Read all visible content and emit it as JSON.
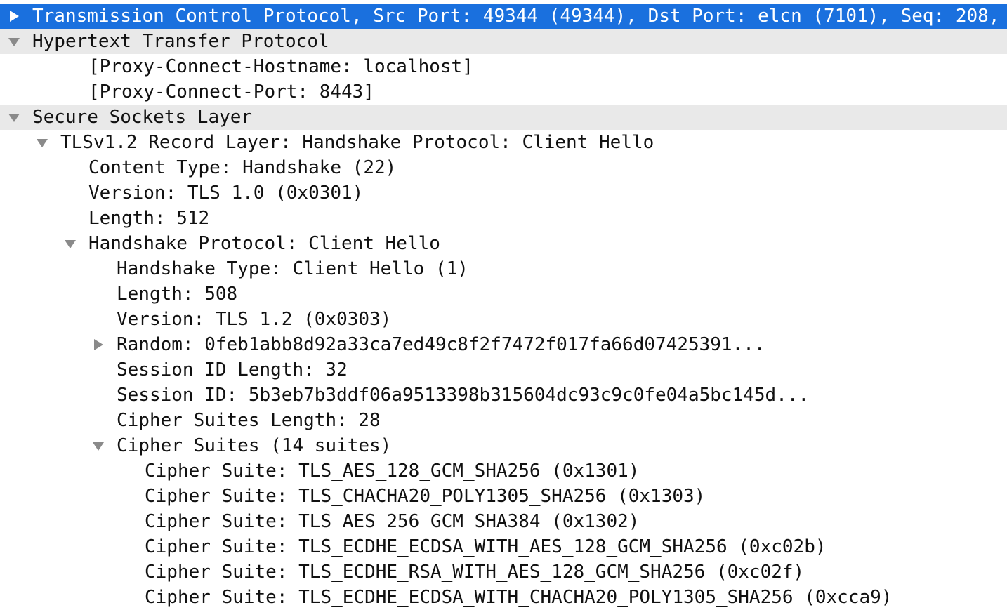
{
  "tree": [
    {
      "level": 0,
      "state": "collapsed",
      "selected": true,
      "section": false,
      "text": "Transmission Control Protocol, Src Port: 49344 (49344), Dst Port: elcn (7101), Seq: 208,"
    },
    {
      "level": 0,
      "state": "expanded",
      "selected": false,
      "section": true,
      "text": "Hypertext Transfer Protocol"
    },
    {
      "level": 2,
      "state": "none",
      "selected": false,
      "section": false,
      "text": "[Proxy-Connect-Hostname: localhost]"
    },
    {
      "level": 2,
      "state": "none",
      "selected": false,
      "section": false,
      "text": "[Proxy-Connect-Port: 8443]"
    },
    {
      "level": 0,
      "state": "expanded",
      "selected": false,
      "section": true,
      "text": "Secure Sockets Layer"
    },
    {
      "level": 1,
      "state": "expanded",
      "selected": false,
      "section": false,
      "text": "TLSv1.2 Record Layer: Handshake Protocol: Client Hello"
    },
    {
      "level": 2,
      "state": "none",
      "selected": false,
      "section": false,
      "text": "Content Type: Handshake (22)"
    },
    {
      "level": 2,
      "state": "none",
      "selected": false,
      "section": false,
      "text": "Version: TLS 1.0 (0x0301)"
    },
    {
      "level": 2,
      "state": "none",
      "selected": false,
      "section": false,
      "text": "Length: 512"
    },
    {
      "level": 2,
      "state": "expanded",
      "selected": false,
      "section": false,
      "text": "Handshake Protocol: Client Hello"
    },
    {
      "level": 3,
      "state": "none",
      "selected": false,
      "section": false,
      "text": "Handshake Type: Client Hello (1)"
    },
    {
      "level": 3,
      "state": "none",
      "selected": false,
      "section": false,
      "text": "Length: 508"
    },
    {
      "level": 3,
      "state": "none",
      "selected": false,
      "section": false,
      "text": "Version: TLS 1.2 (0x0303)"
    },
    {
      "level": 3,
      "state": "collapsed",
      "selected": false,
      "section": false,
      "text": "Random: 0feb1abb8d92a33ca7ed49c8f2f7472f017fa66d07425391..."
    },
    {
      "level": 3,
      "state": "none",
      "selected": false,
      "section": false,
      "text": "Session ID Length: 32"
    },
    {
      "level": 3,
      "state": "none",
      "selected": false,
      "section": false,
      "text": "Session ID: 5b3eb7b3ddf06a9513398b315604dc93c9c0fe04a5bc145d..."
    },
    {
      "level": 3,
      "state": "none",
      "selected": false,
      "section": false,
      "text": "Cipher Suites Length: 28"
    },
    {
      "level": 3,
      "state": "expanded",
      "selected": false,
      "section": false,
      "text": "Cipher Suites (14 suites)"
    },
    {
      "level": 4,
      "state": "none",
      "selected": false,
      "section": false,
      "text": "Cipher Suite: TLS_AES_128_GCM_SHA256 (0x1301)"
    },
    {
      "level": 4,
      "state": "none",
      "selected": false,
      "section": false,
      "text": "Cipher Suite: TLS_CHACHA20_POLY1305_SHA256 (0x1303)"
    },
    {
      "level": 4,
      "state": "none",
      "selected": false,
      "section": false,
      "text": "Cipher Suite: TLS_AES_256_GCM_SHA384 (0x1302)"
    },
    {
      "level": 4,
      "state": "none",
      "selected": false,
      "section": false,
      "text": "Cipher Suite: TLS_ECDHE_ECDSA_WITH_AES_128_GCM_SHA256 (0xc02b)"
    },
    {
      "level": 4,
      "state": "none",
      "selected": false,
      "section": false,
      "text": "Cipher Suite: TLS_ECDHE_RSA_WITH_AES_128_GCM_SHA256 (0xc02f)"
    },
    {
      "level": 4,
      "state": "none",
      "selected": false,
      "section": false,
      "text": "Cipher Suite: TLS_ECDHE_ECDSA_WITH_CHACHA20_POLY1305_SHA256 (0xcca9)"
    }
  ],
  "icons": {
    "expanded": "disclosure-triangle-down-icon",
    "collapsed": "disclosure-triangle-right-icon"
  },
  "colors": {
    "selection": "#1a70de",
    "section_background": "#e9e9e9",
    "disclosure": "#8a8a8a",
    "text": "#111111"
  }
}
